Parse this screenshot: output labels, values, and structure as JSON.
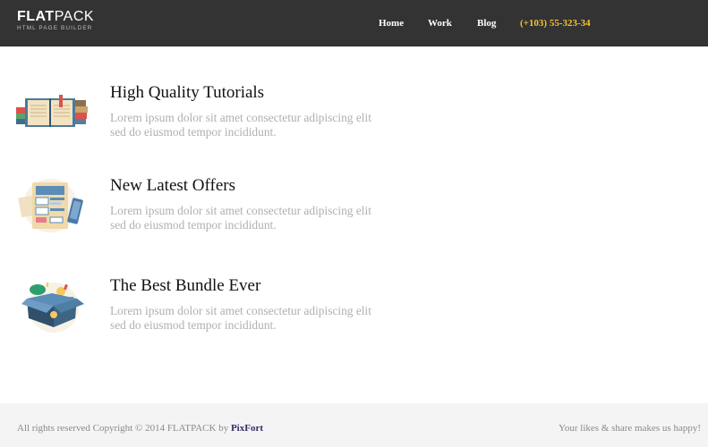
{
  "header": {
    "logo_bold": "FLAT",
    "logo_thin": "PACK",
    "logo_sub": "HTML PAGE BUILDER",
    "nav": [
      "Home",
      "Work",
      "Blog"
    ],
    "phone": "(+103) 55-323-34",
    "colors": {
      "bar": "#333333",
      "accent": "#f4c430"
    }
  },
  "features": [
    {
      "title": "High Quality Tutorials",
      "text": "Lorem ipsum dolor sit amet consectetur adipiscing elit sed do eiusmod tempor incididunt.",
      "icon": "books-icon"
    },
    {
      "title": "New Latest Offers",
      "text": "Lorem ipsum dolor sit amet consectetur adipiscing elit sed do eiusmod tempor incididunt.",
      "icon": "documents-icon"
    },
    {
      "title": "The Best Bundle Ever",
      "text": "Lorem ipsum dolor sit amet consectetur adipiscing elit sed do eiusmod tempor incididunt.",
      "icon": "box-icon"
    }
  ],
  "footer": {
    "copyright": "All rights reserved Copyright © 2014 FLATPACK by ",
    "brand": "PixFort",
    "likes": "Your likes & share makes us happy!"
  }
}
